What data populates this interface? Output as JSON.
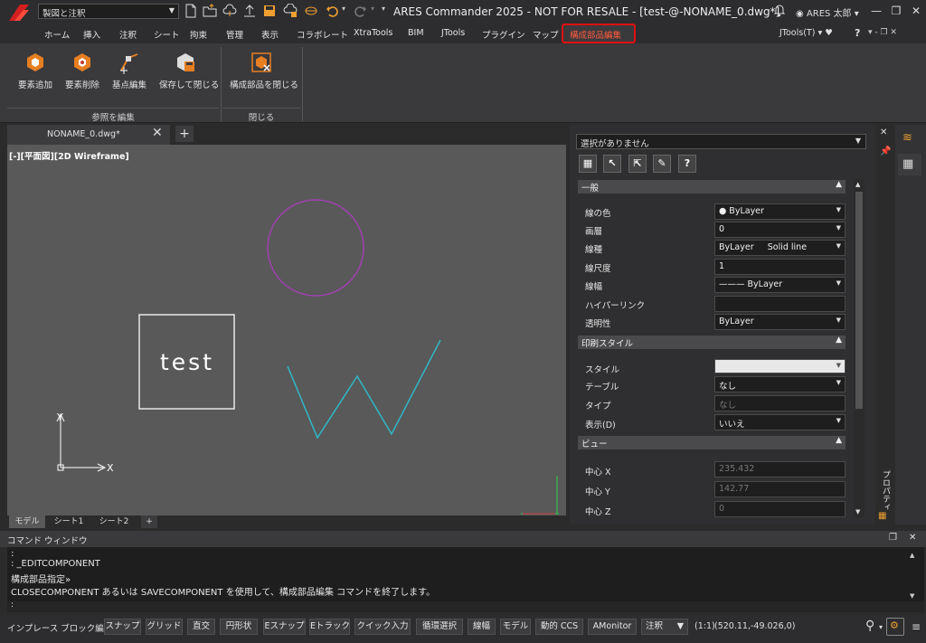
{
  "titlebar": {
    "workspace": "製図と注釈",
    "title": "ARES Commander 2025 - NOT FOR RESALE - [test-@-NONAME_0.dwg*]",
    "user": "ARES 太郎",
    "minimize": "—",
    "restore": "❐",
    "close": "✕"
  },
  "menu": {
    "tabs": [
      "ホーム",
      "挿入",
      "注釈",
      "シート",
      "拘束",
      "管理",
      "表示",
      "コラボレート",
      "XtraTools",
      "BIM",
      "JTools",
      "プラグイン",
      "マップ",
      "構成部品編集"
    ],
    "active": "構成部品編集",
    "right_dropdown": "JTools(T)",
    "help": "?"
  },
  "ribbon": {
    "buttons": [
      {
        "label": "要素追加",
        "icon": "add-entity-icon"
      },
      {
        "label": "要素削除",
        "icon": "remove-entity-icon"
      },
      {
        "label": "基点編集",
        "icon": "base-point-icon"
      },
      {
        "label": "保存して閉じる",
        "icon": "save-close-icon"
      },
      {
        "label": "構成部品を閉じる",
        "icon": "close-component-icon"
      }
    ],
    "groups": [
      "参照を編集",
      "閉じる"
    ]
  },
  "document": {
    "tab_name": "NONAME_0.dwg*",
    "add_tab": "+",
    "view_label": "[-][平面図][2D Wireframe]",
    "text_entity": "test",
    "ucs_x": "X",
    "ucs_y": "Y"
  },
  "layout_tabs": [
    "モデル",
    "シート1",
    "シート2",
    "+"
  ],
  "properties": {
    "selection": "選択がありません",
    "help_tool": "?",
    "sections": {
      "general": {
        "title": "一般",
        "rows": [
          {
            "label": "線の色",
            "value": "● ByLayer"
          },
          {
            "label": "画層",
            "value": "0"
          },
          {
            "label": "線種",
            "value": "ByLayer     Solid line"
          },
          {
            "label": "線尺度",
            "value": "1"
          },
          {
            "label": "線幅",
            "value": "——— ByLayer"
          },
          {
            "label": "ハイパーリンク",
            "value": ""
          },
          {
            "label": "透明性",
            "value": "ByLayer"
          }
        ]
      },
      "print": {
        "title": "印刷スタイル",
        "rows": [
          {
            "label": "スタイル",
            "value": ""
          },
          {
            "label": "テーブル",
            "value": "なし"
          },
          {
            "label": "タイプ",
            "value": "なし"
          },
          {
            "label": "表示(D)",
            "value": "いいえ"
          }
        ]
      },
      "view": {
        "title": "ビュー",
        "rows": [
          {
            "label": "中心 X",
            "value": "235.432"
          },
          {
            "label": "中心 Y",
            "value": "142.77"
          },
          {
            "label": "中心 Z",
            "value": "0"
          }
        ]
      }
    },
    "side_label": "プロパティ"
  },
  "command": {
    "title": "コマンド ウィンドウ",
    "lines": [
      ":",
      ": _EDITCOMPONENT",
      "構成部品指定»",
      "CLOSECOMPONENT あるいは SAVECOMPONENT を使用して、構成部品編集 コマンドを終了します。"
    ],
    "prompt": ":"
  },
  "statusbar": {
    "label": "インプレース ブロック編集",
    "buttons": [
      "スナップ",
      "グリッド",
      "直交",
      "円形状",
      "Eスナップ",
      "Eトラック",
      "クイック入力",
      "循環選択",
      "線幅",
      "モデル",
      "動的 CCS",
      "AMonitor"
    ],
    "annotation": "注釈",
    "scale": "(1:1)",
    "coords": "(520.11,-49.026,0)"
  },
  "colors": {
    "accent_red": "#e01010",
    "circle": "#a040b0",
    "polyline": "#2fb8c8",
    "viewport_bg": "#595959"
  }
}
